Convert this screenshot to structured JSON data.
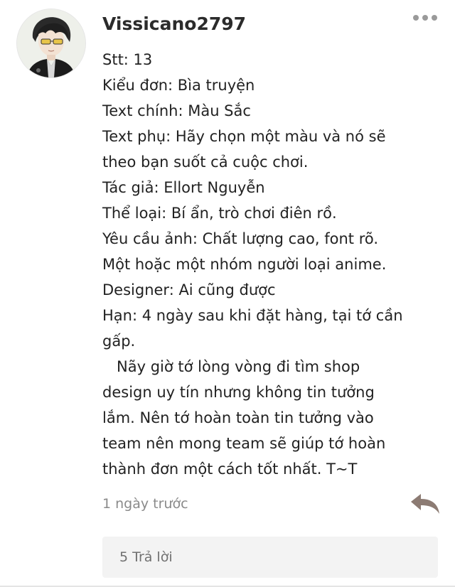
{
  "comment": {
    "avatar_icon": "user-avatar-anime-boy-icon",
    "username": "Vissicano2797",
    "more_icon": "more-options-icon",
    "lines": [
      "Stt: 13",
      "Kiểu đơn: Bìa truyện",
      "Text chính: Màu Sắc",
      "Text phụ: Hãy chọn một màu và nó sẽ",
      "theo bạn suốt cả cuộc chơi.",
      "Tác giả: Ellort Nguyễn",
      "Thể loại: Bí ẩn, trò chơi điên rồ.",
      "Yêu cầu ảnh: Chất lượng cao, font rõ.",
      "Một hoặc một nhóm người loại anime.",
      "Designer: Ai cũng được",
      "Hạn: 4 ngày sau khi đặt hàng, tại tớ cần",
      "gấp.",
      "   Nãy giờ tớ lòng vòng đi tìm shop",
      "design uy tín nhưng không tin tưởng",
      "lắm. Nên tớ hoàn toàn tin tưởng vào",
      "team nên mong team sẽ giúp tớ hoàn",
      "thành đơn một cách tốt nhất. T~T"
    ],
    "timestamp": "1 ngày trước",
    "reply_icon": "reply-arrow-icon",
    "replies_label": "5 Trả lời"
  },
  "colors": {
    "text": "#222222",
    "muted": "#8a8a8a",
    "reply_icon": "#8c7b73",
    "replies_bg": "#f3f3f3"
  }
}
